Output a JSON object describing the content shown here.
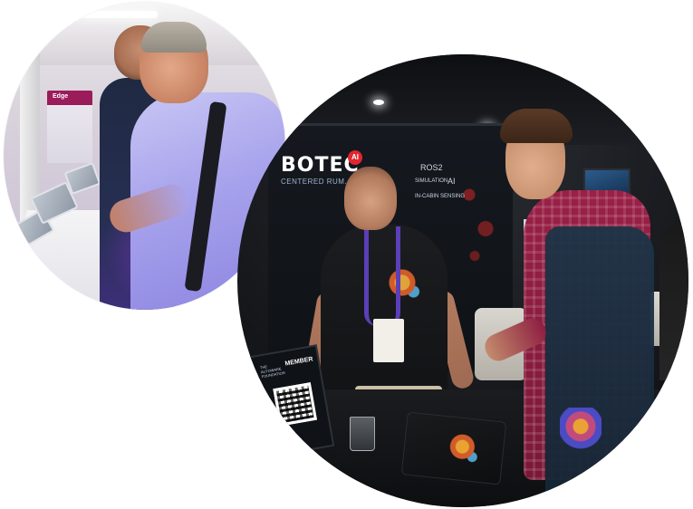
{
  "left_photo": {
    "banner_text": "Edge"
  },
  "right_photo": {
    "brand": "BOTEC",
    "brand_badge": "AI",
    "brand_sub": "CENTERED RUM.AI",
    "booth_text": {
      "ros2": "ROS2",
      "simulation": "SIMULATION",
      "ai": "AI",
      "in_cabin": "IN-CABIN SENSING"
    },
    "sign": {
      "small_text": "THE AUTOWARE FOUNDATION",
      "member": "MEMBER"
    }
  }
}
